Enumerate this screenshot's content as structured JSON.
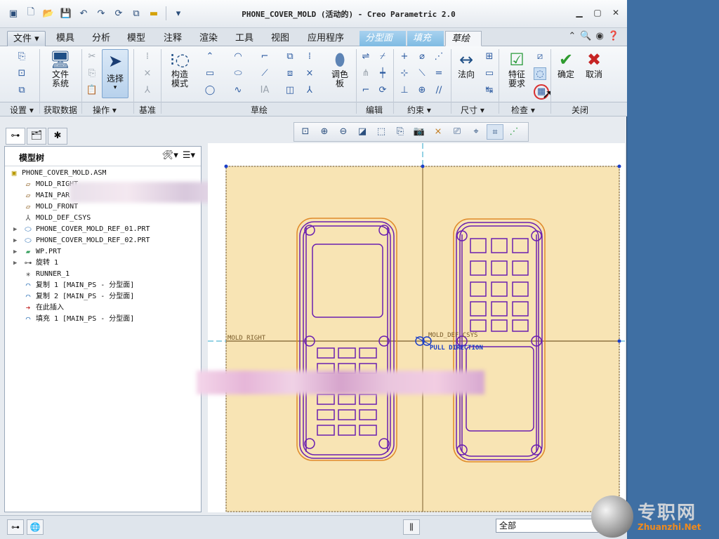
{
  "app": {
    "title": "PHONE_COVER_MOLD (活动的) - Creo Parametric 2.0"
  },
  "tabs": [
    "文件",
    "模具",
    "分析",
    "模型",
    "注释",
    "渲染",
    "工具",
    "视图",
    "应用程序",
    "分型面",
    "填充",
    "草绘"
  ],
  "ribbon": {
    "groups": [
      "设置",
      "获取数据",
      "操作",
      "基准",
      "草绘",
      "编辑",
      "约束",
      "尺寸",
      "检查",
      "关闭"
    ],
    "file_system": [
      "文件",
      "系统"
    ],
    "select": "选择",
    "construct": [
      "构造",
      "模式"
    ],
    "palette": [
      "调色",
      "板"
    ],
    "normal": "法向",
    "feature_req": [
      "特征",
      "要求"
    ],
    "ok": "确定",
    "cancel": "取消"
  },
  "model_tree": {
    "title": "模型树",
    "items": [
      "PHONE_COVER_MOLD.ASM",
      "MOLD_RIGHT",
      "MAIN_PAR",
      "MOLD_FRONT",
      "MOLD_DEF_CSYS",
      "PHONE_COVER_MOLD_REF_01.PRT",
      "PHONE_COVER_MOLD_REF_02.PRT",
      "WP.PRT",
      "旋转 1",
      "RUNNER_1",
      "复制 1 [MAIN_PS - 分型面]",
      "复制 2 [MAIN_PS - 分型面]",
      "在此插入",
      "填充 1 [MAIN_PS - 分型面]"
    ]
  },
  "canvas": {
    "label_mold_right": "MOLD_RIGHT",
    "label_csys": "MOLD_DEF_CSYS",
    "label_pull": "PULL DIRECTION"
  },
  "status": {
    "filter": "全部"
  },
  "watermark": {
    "cn": "专职网",
    "en": "Zhuanzhi.Net"
  },
  "colors": {
    "sketch_plane": "#f8e4b4",
    "geometry": "#6a1fb0",
    "datum": "#2aa6c9",
    "accent_tab": "#8cc4ea"
  }
}
